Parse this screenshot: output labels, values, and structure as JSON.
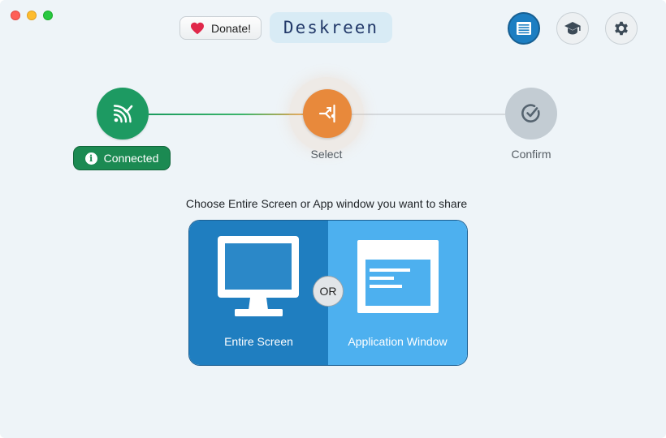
{
  "window": {
    "traffic_lights": [
      "close",
      "minimize",
      "zoom"
    ]
  },
  "header": {
    "donate_label": "Donate!",
    "brand_title": "Deskreen",
    "icons": [
      "heart-icon",
      "list-icon",
      "graduation-cap-icon",
      "gear-icon"
    ],
    "active_icon": "list-icon"
  },
  "stepper": {
    "steps": [
      {
        "label": "Connected",
        "state": "complete",
        "icon": "wifi-check-icon"
      },
      {
        "label": "Select",
        "state": "active",
        "icon": "share-icon"
      },
      {
        "label": "Confirm",
        "state": "pending",
        "icon": "check-circle-icon"
      }
    ]
  },
  "main": {
    "prompt": "Choose Entire Screen or App window you want to share",
    "options": {
      "entire_screen": "Entire Screen",
      "or_label": "OR",
      "application_window": "Application Window"
    }
  },
  "colors": {
    "connected": "#1d9a62",
    "select": "#e8893b",
    "confirm": "#c3ccd3",
    "entire_screen_bg": "#1f7ec0",
    "app_window_bg": "#4db0ef",
    "accent": "#1c7ec2"
  }
}
